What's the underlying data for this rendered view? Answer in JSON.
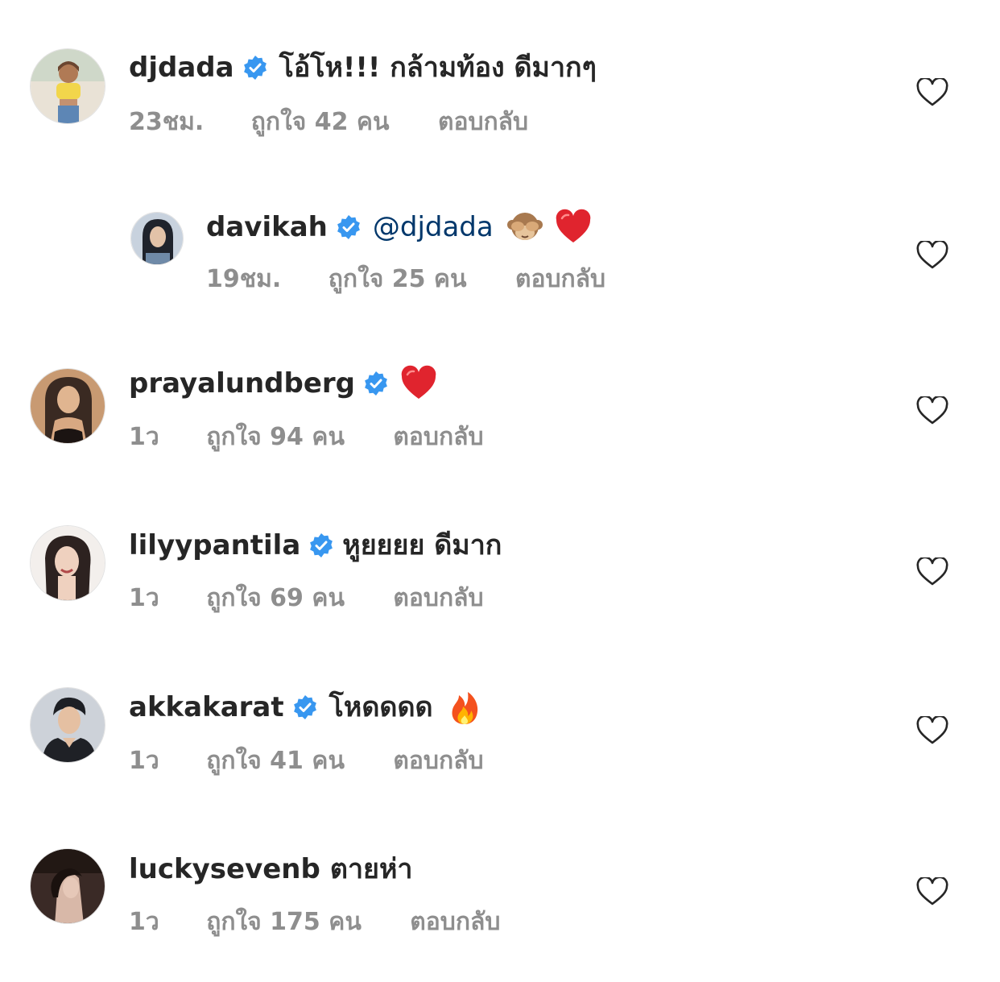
{
  "comments": [
    {
      "username": "djdada",
      "verified": true,
      "text": "โอ้โห!!! กล้ามท้อง ดีมากๆ",
      "time": "23ชม.",
      "likes": "ถูกใจ 42 คน",
      "reply": "ตอบกลับ",
      "avatar_colors": [
        "#f2d64b",
        "#8cb7d6"
      ]
    },
    {
      "username": "davikah",
      "verified": true,
      "mention": "@djdada",
      "emojis": [
        "see-no-evil-monkey-emoji",
        "red-heart-emoji"
      ],
      "time": "19ชม.",
      "likes": "ถูกใจ 25 คน",
      "reply": "ตอบกลับ",
      "avatar_colors": [
        "#2a2f3a",
        "#c8d2de"
      ]
    },
    {
      "username": "prayalundberg",
      "verified": true,
      "emojis": [
        "red-heart-emoji"
      ],
      "time": "1ว",
      "likes": "ถูกใจ 94 คน",
      "reply": "ตอบกลับ",
      "avatar_colors": [
        "#b88862",
        "#3a2a22"
      ]
    },
    {
      "username": "lilyypantila",
      "verified": true,
      "text": "หูยยยย ดีมาก",
      "time": "1ว",
      "likes": "ถูกใจ 69 คน",
      "reply": "ตอบกลับ",
      "avatar_colors": [
        "#f0ece8",
        "#2d2220"
      ]
    },
    {
      "username": "akkakarat",
      "verified": true,
      "text": "โหดดดด",
      "emojis": [
        "fire-emoji"
      ],
      "time": "1ว",
      "likes": "ถูกใจ 41 คน",
      "reply": "ตอบกลับ",
      "avatar_colors": [
        "#c9ced6",
        "#1d1f24"
      ]
    },
    {
      "username": "luckysevenb",
      "verified": false,
      "text": "ตายห่า",
      "time": "1ว",
      "likes": "ถูกใจ 175 คน",
      "reply": "ตอบกลับ",
      "avatar_colors": [
        "#3a2a26",
        "#d8b8a8"
      ]
    }
  ],
  "colors": {
    "text": "#262626",
    "meta": "#8e8e8e",
    "verified_badge": "#3897f0",
    "mention": "#00376b"
  }
}
